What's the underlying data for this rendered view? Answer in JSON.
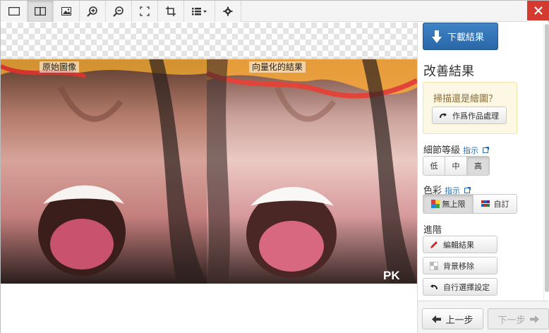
{
  "toolbar": {
    "buttons": [
      {
        "name": "single-view-icon",
        "active": false
      },
      {
        "name": "split-view-icon",
        "active": true
      },
      {
        "name": "image-icon",
        "active": false
      },
      {
        "name": "zoom-in-icon",
        "active": false
      },
      {
        "name": "zoom-out-icon",
        "active": false
      },
      {
        "name": "fit-to-screen-icon",
        "active": false
      },
      {
        "name": "crop-icon",
        "active": false
      },
      {
        "name": "list-menu-icon",
        "active": false
      },
      {
        "name": "gear-icon",
        "active": false
      }
    ],
    "close_icon": "close-icon"
  },
  "canvas": {
    "left_label": "原始圖像",
    "right_label": "向量化的結果",
    "watermark": "PK"
  },
  "sidebar": {
    "download_label": "下載結果",
    "improve_title": "改善結果",
    "scan_question": "掃描還是繪圖？",
    "process_as_artwork": "作爲作品處理",
    "detail_label": "細節等級",
    "detail_hint": "指示",
    "detail_options": [
      "低",
      "中",
      "高"
    ],
    "detail_selected": "高",
    "color_label": "色彩",
    "color_hint": "指示",
    "color_options": [
      "無上限",
      "自訂"
    ],
    "color_selected": "無上限",
    "advanced_label": "進階",
    "edit_result": "編輯結果",
    "bg_removal": "背景移除",
    "custom_settings": "自行選擇設定",
    "prev_step": "上一步",
    "next_step": "下一步"
  },
  "colors": {
    "accent_blue": "#2a66a8",
    "close_red": "#d43a2f",
    "hint_bg": "#fcf8e3"
  }
}
